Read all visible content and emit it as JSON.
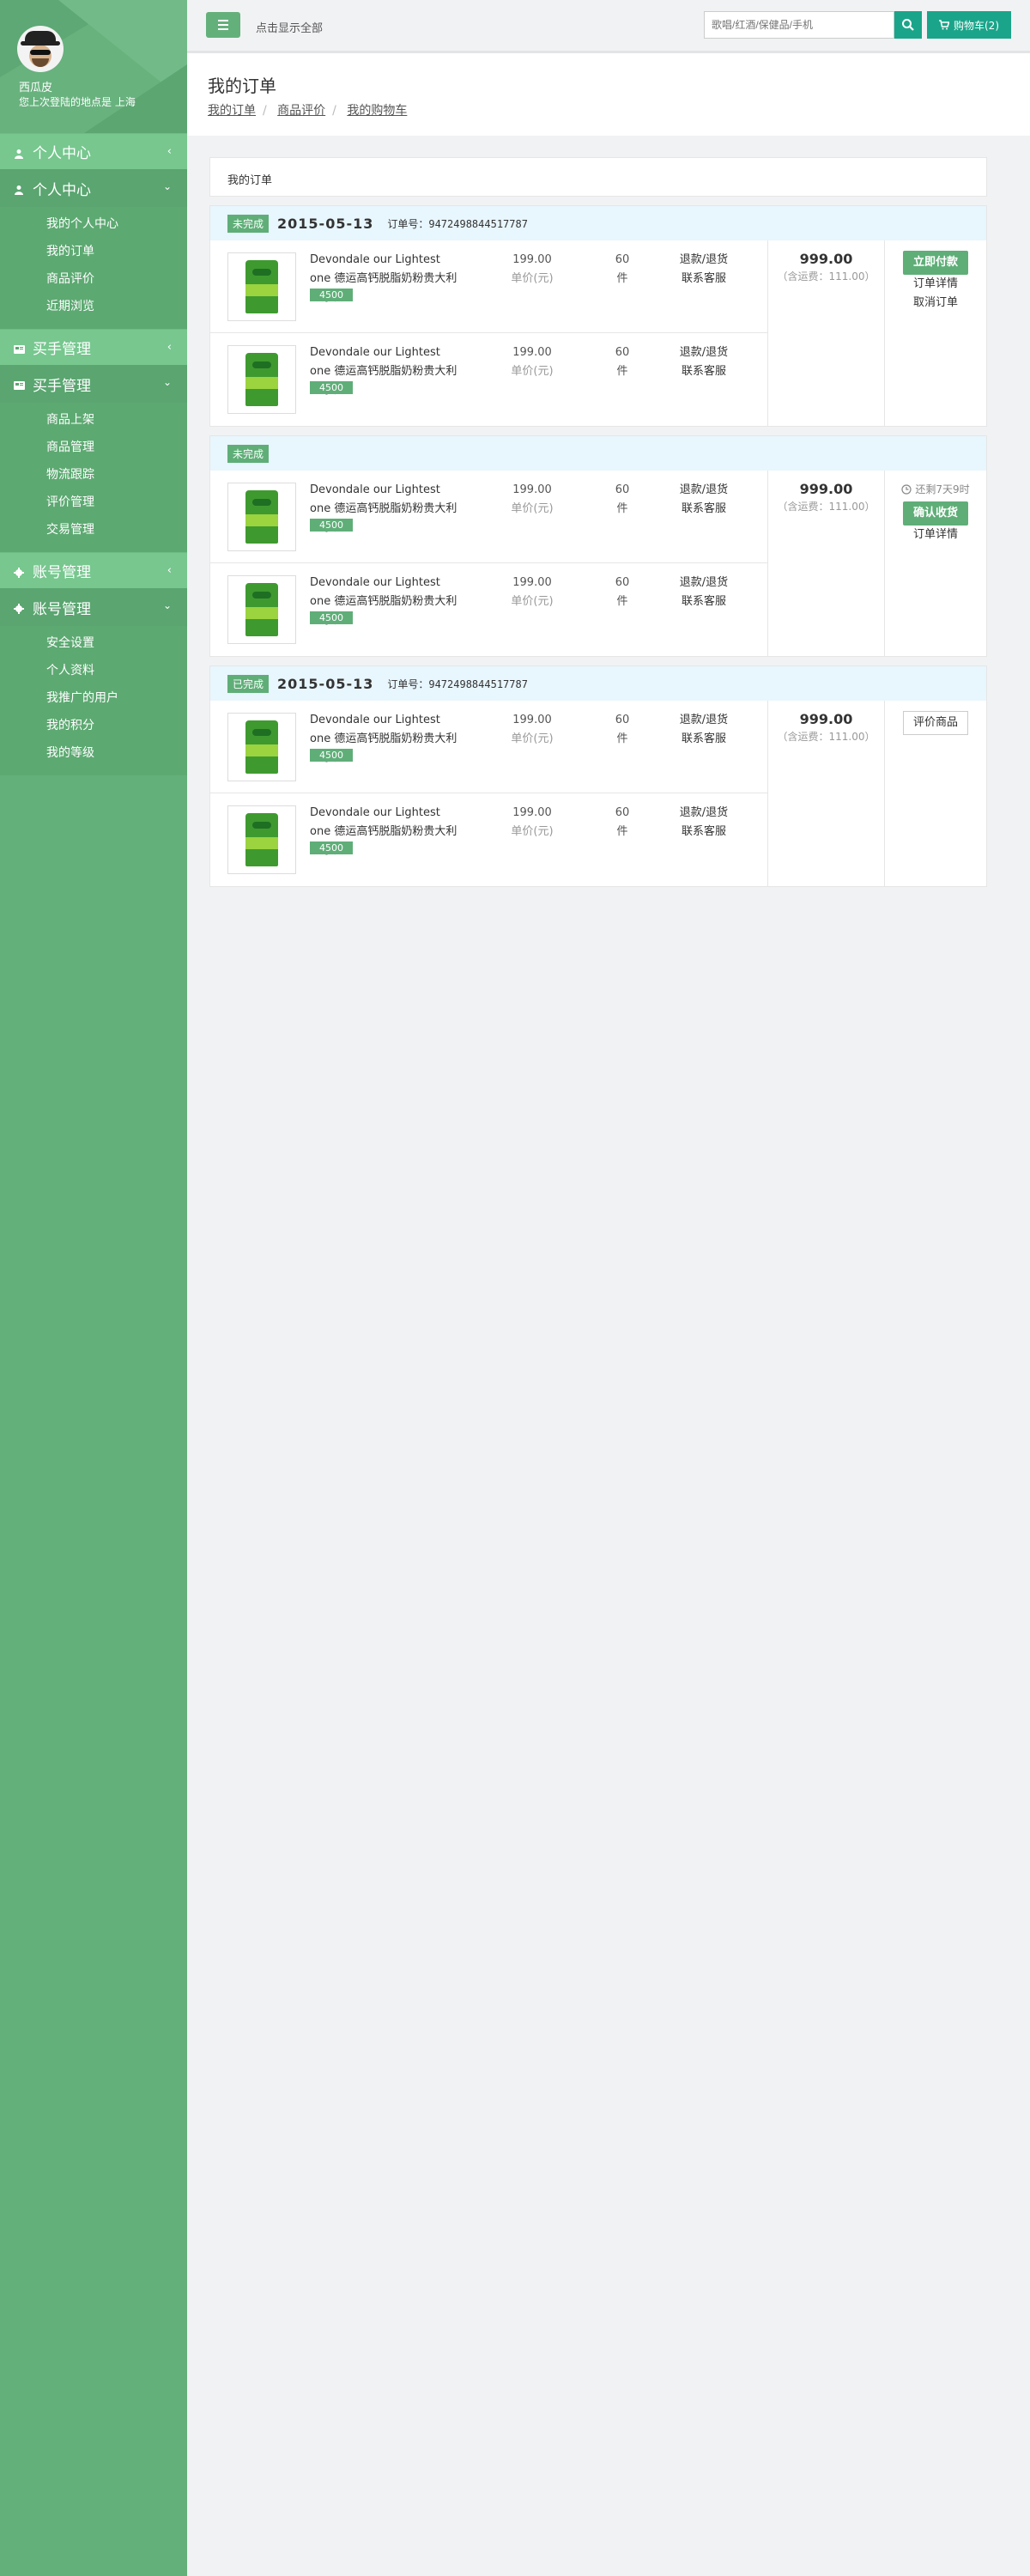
{
  "profile": {
    "name": "西瓜皮",
    "location": "您上次登陆的地点是 上海"
  },
  "menu": [
    {
      "id": "personal",
      "header": "个人中心",
      "sub": "个人中心",
      "items": [
        "我的个人中心",
        "我的订单",
        "商品评价",
        "近期浏览"
      ]
    },
    {
      "id": "buyer",
      "header": "买手管理",
      "sub": "买手管理",
      "items": [
        "商品上架",
        "商品管理",
        "物流跟踪",
        "评价管理",
        "交易管理"
      ]
    },
    {
      "id": "account",
      "header": "账号管理",
      "sub": "账号管理",
      "items": [
        "安全设置",
        "个人资料",
        "我推广的用户",
        "我的积分",
        "我的等级"
      ]
    }
  ],
  "topbar": {
    "toggle_label": "点击显示全部",
    "search_placeholder": "歌唱/红酒/保健品/手机",
    "cart_label": "购物车(2)"
  },
  "page": {
    "title": "我的订单",
    "breadcrumb": [
      "我的订单",
      "商品评价",
      "我的购物车"
    ]
  },
  "section_title": "我的订单",
  "orders": [
    {
      "status": "未完成",
      "date": "2015-05-13",
      "order_no": "订单号：9472498844517787",
      "items": [
        {
          "name": "Devondale our Lightest one 德运高钙脱脂奶粉贵大利亚原装",
          "tag": "4500",
          "price": "199.00",
          "price_label": "单价(元)",
          "qty": "60",
          "unit": "件",
          "svc1": "退款/退货",
          "svc2": "联系客服"
        },
        {
          "name": "Devondale our Lightest one 德运高钙脱脂奶粉贵大利亚原装",
          "tag": "4500",
          "price": "199.00",
          "price_label": "单价(元)",
          "qty": "60",
          "unit": "件",
          "svc1": "退款/退货",
          "svc2": "联系客服"
        }
      ],
      "total": "999.00",
      "shipping": "（含运费：111.00）",
      "primary_action": "立即付款",
      "links": [
        "订单详情",
        "取消订单"
      ]
    },
    {
      "status": "未完成",
      "date": "",
      "order_no": "",
      "items": [
        {
          "name": "Devondale our Lightest one 德运高钙脱脂奶粉贵大利亚原装",
          "tag": "4500",
          "price": "199.00",
          "price_label": "单价(元)",
          "qty": "60",
          "unit": "件",
          "svc1": "退款/退货",
          "svc2": "联系客服"
        },
        {
          "name": "Devondale our Lightest one 德运高钙脱脂奶粉贵大利亚原装",
          "tag": "4500",
          "price": "199.00",
          "price_label": "单价(元)",
          "qty": "60",
          "unit": "件",
          "svc1": "退款/退货",
          "svc2": "联系客服"
        }
      ],
      "total": "999.00",
      "shipping": "（含运费：111.00）",
      "countdown": "还剩7天9时",
      "primary_action": "确认收货",
      "links": [
        "订单详情"
      ]
    },
    {
      "status": "已完成",
      "date": "2015-05-13",
      "order_no": "订单号：9472498844517787",
      "items": [
        {
          "name": "Devondale our Lightest one 德运高钙脱脂奶粉贵大利亚原装",
          "tag": "4500",
          "price": "199.00",
          "price_label": "单价(元)",
          "qty": "60",
          "unit": "件",
          "svc1": "退款/退货",
          "svc2": "联系客服"
        },
        {
          "name": "Devondale our Lightest one 德运高钙脱脂奶粉贵大利亚原装",
          "tag": "4500",
          "price": "199.00",
          "price_label": "单价(元)",
          "qty": "60",
          "unit": "件",
          "svc1": "退款/退货",
          "svc2": "联系客服"
        }
      ],
      "total": "999.00",
      "shipping": "（含运费：111.00）",
      "outline_action": "评价商品"
    }
  ],
  "colors": {
    "sidebar": "#64b07b",
    "menu_header": "#77c78f",
    "accent": "#1aa58a",
    "status_badge": "#5fae78",
    "order_head": "#e8f6fd"
  }
}
